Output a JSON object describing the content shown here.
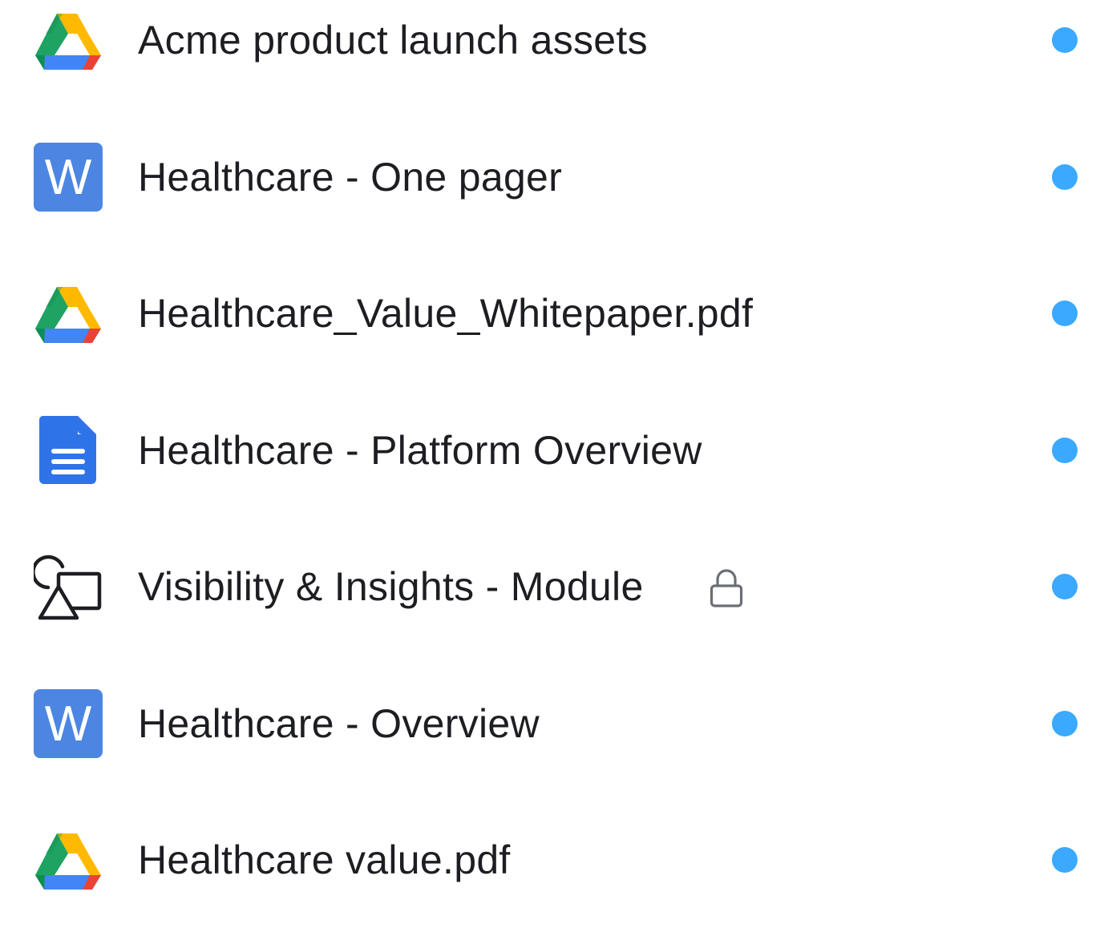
{
  "colors": {
    "status_dot": "#3aa9ff",
    "text": "#1d1e22",
    "word_blue": "#4c86e2",
    "docs_blue": "#2f73e8",
    "drive_green": "#1ea362",
    "drive_yellow": "#ffba00",
    "drive_blue": "#4285f4",
    "drive_red": "#ea4335"
  },
  "files": [
    {
      "name": "Acme product launch assets",
      "icon": "google-drive-icon",
      "locked": false,
      "status": "dot"
    },
    {
      "name": "Healthcare - One pager",
      "icon": "word-doc-icon",
      "locked": false,
      "status": "dot"
    },
    {
      "name": "Healthcare_Value_Whitepaper.pdf",
      "icon": "google-drive-icon",
      "locked": false,
      "status": "dot"
    },
    {
      "name": "Healthcare - Platform Overview",
      "icon": "google-docs-icon",
      "locked": false,
      "status": "dot"
    },
    {
      "name": "Visibility & Insights - Module",
      "icon": "shapes-icon",
      "locked": true,
      "status": "dot"
    },
    {
      "name": "Healthcare - Overview",
      "icon": "word-doc-icon",
      "locked": false,
      "status": "dot"
    },
    {
      "name": "Healthcare value.pdf",
      "icon": "google-drive-icon",
      "locked": false,
      "status": "dot"
    }
  ],
  "icons": {
    "word_letter": "W"
  }
}
